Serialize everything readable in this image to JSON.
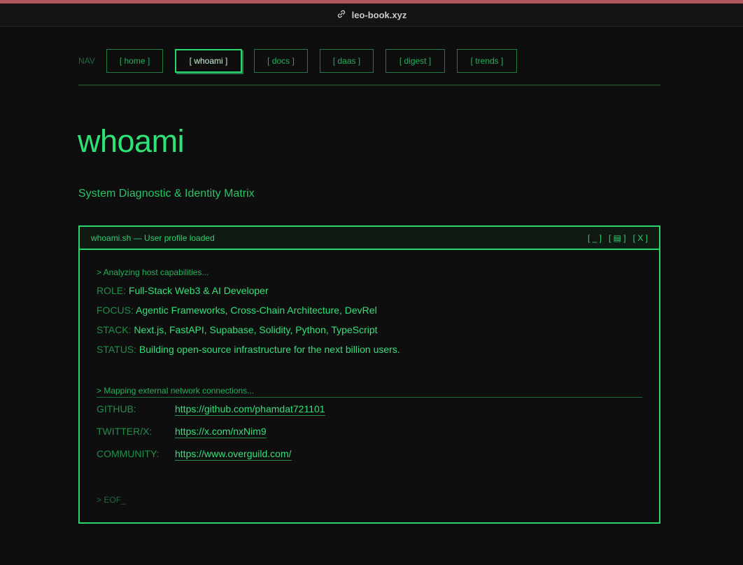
{
  "browser": {
    "url": "leo-book.xyz",
    "accent_color": "#b0565f"
  },
  "nav": {
    "label": "NAV",
    "items": [
      {
        "label": "[ home ]",
        "active": false
      },
      {
        "label": "[ whoami ]",
        "active": true
      },
      {
        "label": "[ docs ]",
        "active": false
      },
      {
        "label": "[ daas ]",
        "active": false
      },
      {
        "label": "[ digest ]",
        "active": false
      },
      {
        "label": "[ trends ]",
        "active": false
      }
    ]
  },
  "page": {
    "title": "whoami",
    "subtitle": "System Diagnostic & Identity Matrix"
  },
  "terminal": {
    "title": "whoami.sh — User profile loaded",
    "controls": [
      "[ _ ]",
      "[ ▤ ]",
      "[ X ]"
    ],
    "prompt1": "> Analyzing host capabilities...",
    "role_key": "ROLE:",
    "role_value": "Full-Stack Web3 & AI Developer",
    "focus_key": "FOCUS:",
    "focus_value": "Agentic Frameworks, Cross-Chain Architecture, DevRel",
    "stack_key": "STACK:",
    "stack_value": "Next.js, FastAPI, Supabase, Solidity, Python, TypeScript",
    "status_key": "STATUS:",
    "status_value": "Building open-source infrastructure for the next billion users.",
    "prompt2": "> Mapping external network connections...",
    "links": [
      {
        "key": "GITHUB:",
        "url": "https://github.com/phamdat721101"
      },
      {
        "key": "TWITTER/X:",
        "url": "https://x.com/nxNim9"
      },
      {
        "key": "COMMUNITY:",
        "url": "https://www.overguild.com/"
      }
    ],
    "eof": "> EOF_"
  },
  "colors": {
    "background": "#0e0e0e",
    "primary_green": "#2ee276",
    "dim_green": "#1f8f4a"
  }
}
